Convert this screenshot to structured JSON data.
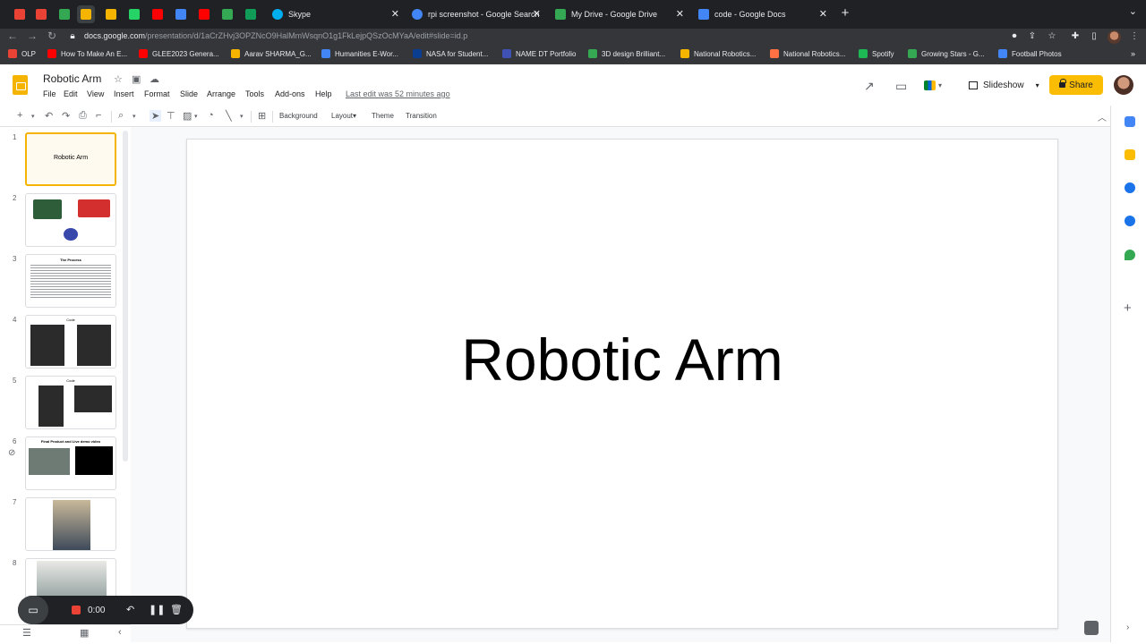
{
  "browser": {
    "tabs": [
      {
        "label": "Skype",
        "color": "#00aff0"
      },
      {
        "label": "rpi screenshot - Google Search",
        "color": "#4285f4"
      },
      {
        "label": "My Drive - Google Drive",
        "color": "#34a853"
      },
      {
        "label": "code - Google Docs",
        "color": "#4285f4"
      }
    ],
    "pinned_colors": [
      "#ea4335",
      "#ea4335",
      "#34a853",
      "#f4b400",
      "#f4b400",
      "#25d366",
      "#ff0000",
      "#4285f4",
      "#ff0000",
      "#34a853",
      "#0f9d58"
    ],
    "url_host": "docs.google.com",
    "url_path": "/presentation/d/1aCrZHvj3OPZNcO9HalMmWsqnO1g1FkLejpQSzOcMYaA/edit#slide=id.p",
    "bookmarks": [
      {
        "label": "OLP",
        "color": "#ea4335"
      },
      {
        "label": "How To Make An E...",
        "color": "#ff0000"
      },
      {
        "label": "GLEE2023 Genera...",
        "color": "#ff0000"
      },
      {
        "label": "Aarav SHARMA_G...",
        "color": "#f4b400"
      },
      {
        "label": "Humanities E-Wor...",
        "color": "#4285f4"
      },
      {
        "label": "NASA for Student...",
        "color": "#0b3d91"
      },
      {
        "label": "NAME DT Portfolio",
        "color": "#3f51b5"
      },
      {
        "label": "3D design Brilliant...",
        "color": "#34a853"
      },
      {
        "label": "National Robotics...",
        "color": "#f4b400"
      },
      {
        "label": "National Robotics...",
        "color": "#ff7043"
      },
      {
        "label": "Spotify",
        "color": "#1db954"
      },
      {
        "label": "Growing Stars - G...",
        "color": "#34a853"
      },
      {
        "label": "Football Photos",
        "color": "#4285f4"
      }
    ]
  },
  "app": {
    "title": "Robotic Arm",
    "menus": [
      "File",
      "Edit",
      "View",
      "Insert",
      "Format",
      "Slide",
      "Arrange",
      "Tools",
      "Add-ons",
      "Help"
    ],
    "last_edit": "Last edit was 52 minutes ago",
    "slideshow_label": "Slideshow",
    "share_label": "Share",
    "accent": "#fbbc04"
  },
  "toolbar": {
    "background": "Background",
    "layout": "Layout",
    "theme": "Theme",
    "transition": "Transition"
  },
  "filmstrip": {
    "slides": [
      {
        "number": "1",
        "title": "Robotic Arm"
      },
      {
        "number": "2",
        "title": ""
      },
      {
        "number": "3",
        "title": "The Process"
      },
      {
        "number": "4",
        "title": "Code"
      },
      {
        "number": "5",
        "title": "Code"
      },
      {
        "number": "6",
        "title": "Final Product and Live demo video"
      },
      {
        "number": "7",
        "title": ""
      },
      {
        "number": "8",
        "title": ""
      }
    ]
  },
  "slide": {
    "title": "Robotic Arm"
  },
  "recorder": {
    "time": "0:00"
  }
}
